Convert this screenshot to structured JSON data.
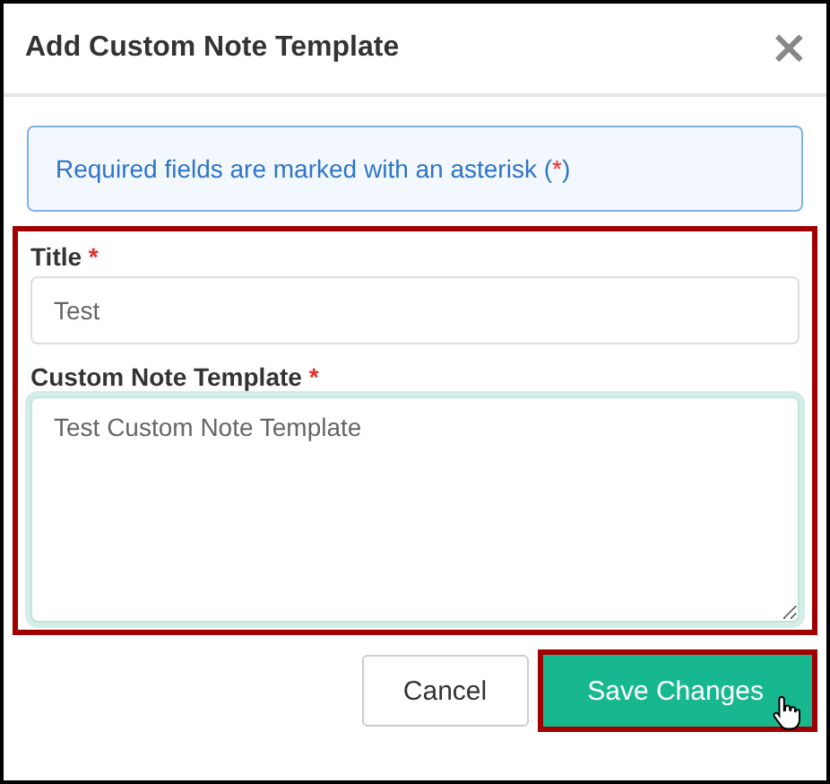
{
  "dialog": {
    "title": "Add Custom Note Template",
    "close": "×"
  },
  "notice": {
    "text": "Required fields are marked with an asterisk (",
    "marker": "*",
    "suffix": ")"
  },
  "form": {
    "highlighted": true,
    "fields": [
      {
        "label": "Title",
        "required": true,
        "kind": "input",
        "value": "Test",
        "focused": false
      },
      {
        "label": "Custom Note Template",
        "required": true,
        "kind": "textarea",
        "value": "Test Custom Note Template",
        "focused": true
      }
    ]
  },
  "buttons": [
    {
      "label": "Cancel",
      "kind": "secondary",
      "highlighted": false,
      "hovered": false
    },
    {
      "label": "Save Changes",
      "kind": "primary",
      "highlighted": true,
      "hovered": true
    }
  ]
}
